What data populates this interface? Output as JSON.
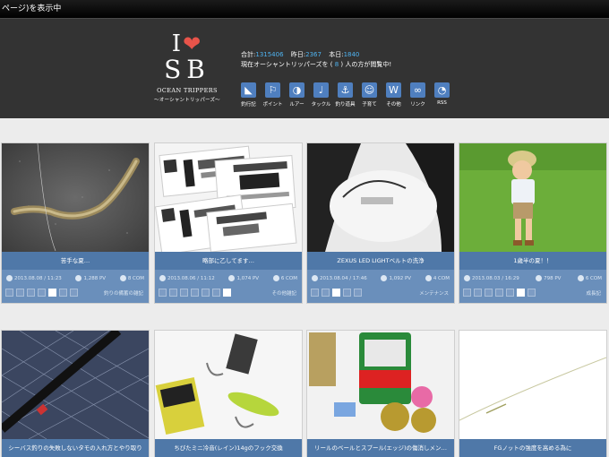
{
  "status_text": "ページ)を表示中",
  "site": {
    "logo_top": "I",
    "logo_sb": "SB",
    "logo_name": "OCEAN TRIPPERS",
    "logo_sub": "～オーシャントリッパーズ～"
  },
  "stats": {
    "total_label": "合計:",
    "total_value": "1315406",
    "yesterday_label": "昨日:",
    "yesterday_value": "2367",
    "today_label": "本日:",
    "today_value": "1840",
    "online_prefix": "現在オーシャントリッパーズを",
    "online_open": "(",
    "online_count": "8",
    "online_close": ")",
    "online_suffix": "人の方が閲覧中!"
  },
  "nav": [
    {
      "label": "釣行記",
      "icon": "fishing-log-icon",
      "glyph": "◣"
    },
    {
      "label": "ポイント",
      "icon": "point-icon",
      "glyph": "⚐"
    },
    {
      "label": "ルアー",
      "icon": "lure-icon",
      "glyph": "◑"
    },
    {
      "label": "タックル",
      "icon": "tackle-icon",
      "glyph": "♩"
    },
    {
      "label": "釣り道具",
      "icon": "hook-icon",
      "glyph": "⚓"
    },
    {
      "label": "子育て",
      "icon": "baby-icon",
      "glyph": "☺"
    },
    {
      "label": "その他",
      "icon": "wordpress-icon",
      "glyph": "W"
    },
    {
      "label": "リンク",
      "icon": "link-icon",
      "glyph": "∞"
    },
    {
      "label": "RSS",
      "icon": "rss-icon",
      "glyph": "◔"
    }
  ],
  "posts": [
    {
      "title": "苦手な夏…",
      "date": "2013.08.08 / 11:23",
      "pv": "1,288 PV",
      "com": "8 COM",
      "category": "釣りの備蓄の雑記",
      "active": 4
    },
    {
      "title": "略部に乙してます…",
      "date": "2013.08.06 / 11:12",
      "pv": "1,074 PV",
      "com": "6 COM",
      "category": "その他雑記",
      "active": 6
    },
    {
      "title": "ZEXUS LED LIGHTベルトの洗浄",
      "date": "2013.08.04 / 17:46",
      "pv": "1,092 PV",
      "com": "4 COM",
      "category": "メンテナンス",
      "active": 2
    },
    {
      "title": "1歳半の夏！！",
      "date": "2013.08.03 / 16:29",
      "pv": "798 PV",
      "com": "6 COM",
      "category": "成長記",
      "active": 5
    },
    {
      "title": "シーバス釣りの失敗しないタモの入れ方とやり取り"
    },
    {
      "title": "ちびたミニ冷音(レイン)14gのフック交換"
    },
    {
      "title": "リールのベールとスプール(エッジ)の傷消しメン…"
    },
    {
      "title": "FGノットの強度を高める為に"
    }
  ]
}
